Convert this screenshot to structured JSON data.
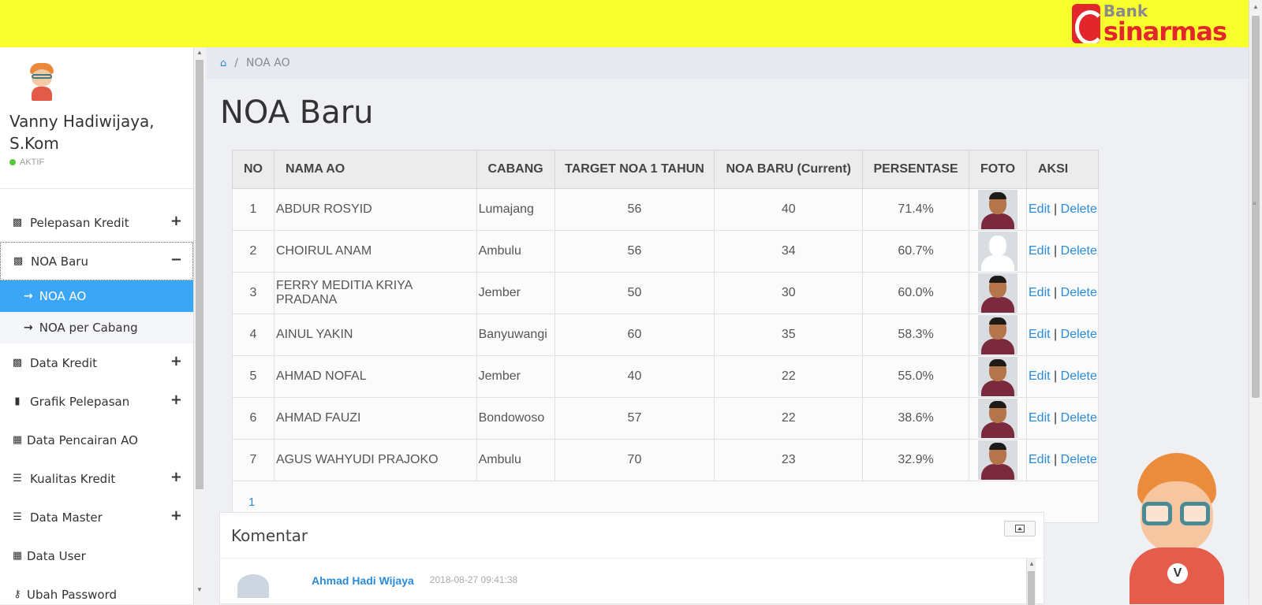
{
  "header": {
    "logo_bank": "Bank",
    "logo_name": "sinarmas"
  },
  "profile": {
    "name": "Vanny Hadiwijaya, S.Kom",
    "status": "AKTIF"
  },
  "menu": [
    {
      "label": "Pelepasan Kredit",
      "icon": "money-icon",
      "toggle": "+"
    },
    {
      "label": "NOA Baru",
      "icon": "money-icon",
      "toggle": "−"
    },
    {
      "label": "Data Kredit",
      "icon": "money-icon",
      "toggle": "+"
    },
    {
      "label": "Grafik Pelepasan",
      "icon": "bar-chart-icon",
      "toggle": "+"
    },
    {
      "label": "Data Pencairan AO",
      "icon": "calendar-icon",
      "toggle": ""
    },
    {
      "label": "Kualitas Kredit",
      "icon": "list-icon",
      "toggle": "+"
    },
    {
      "label": "Data Master",
      "icon": "list-icon",
      "toggle": "+"
    },
    {
      "label": "Data User",
      "icon": "calendar-icon",
      "toggle": ""
    },
    {
      "label": "Ubah Password",
      "icon": "key-icon",
      "toggle": ""
    }
  ],
  "submenu": [
    {
      "label": "NOA AO",
      "active": true
    },
    {
      "label": "NOA per Cabang",
      "active": false
    }
  ],
  "breadcrumb": {
    "current": "NOA AO"
  },
  "page_title": "NOA Baru",
  "table": {
    "headers": [
      "NO",
      "NAMA AO",
      "CABANG",
      "TARGET NOA 1 TAHUN",
      "NOA BARU (Current)",
      "PERSENTASE",
      "FOTO",
      "AKSI"
    ],
    "rows": [
      {
        "no": "1",
        "nama": "ABDUR ROSYID",
        "cabang": "Lumajang",
        "target": "56",
        "current": "40",
        "persen": "71.4%"
      },
      {
        "no": "2",
        "nama": "CHOIRUL ANAM",
        "cabang": "Ambulu",
        "target": "56",
        "current": "34",
        "persen": "60.7%"
      },
      {
        "no": "3",
        "nama": "FERRY MEDITIA KRIYA PRADANA",
        "cabang": "Jember",
        "target": "50",
        "current": "30",
        "persen": "60.0%"
      },
      {
        "no": "4",
        "nama": "AINUL YAKIN",
        "cabang": "Banyuwangi",
        "target": "60",
        "current": "35",
        "persen": "58.3%"
      },
      {
        "no": "5",
        "nama": "AHMAD NOFAL",
        "cabang": "Jember",
        "target": "40",
        "current": "22",
        "persen": "55.0%"
      },
      {
        "no": "6",
        "nama": "AHMAD FAUZI",
        "cabang": "Bondowoso",
        "target": "57",
        "current": "22",
        "persen": "38.6%"
      },
      {
        "no": "7",
        "nama": "AGUS WAHYUDI PRAJOKO",
        "cabang": "Ambulu",
        "target": "70",
        "current": "23",
        "persen": "32.9%"
      }
    ],
    "edit_label": "Edit",
    "delete_label": "Delete",
    "separator": "|",
    "pager": "1"
  },
  "komentar": {
    "title": "Komentar",
    "author": "Ahmad Hadi Wijaya",
    "time": "2018-08-27 09:41:38"
  },
  "colors": {
    "topbar": "#f8ff2d",
    "accent": "#3aa6f5",
    "link": "#2a8bd8",
    "brand_red": "#e3262b"
  }
}
